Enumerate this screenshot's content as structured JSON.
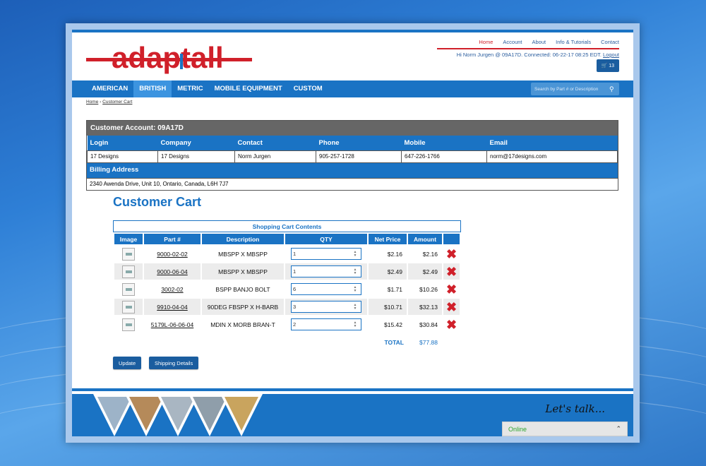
{
  "header": {
    "logo_text": "adaptall",
    "toplinks": [
      "Home",
      "Account",
      "About",
      "Info & Tutorials",
      "Contact"
    ],
    "user_line": "Hi Norm Jurgen @ 09A17D. Connected: 06-22-17 08:25 EDT.",
    "logout": "Logout",
    "cart_count": "13"
  },
  "nav": {
    "items": [
      "AMERICAN",
      "BRITISH",
      "METRIC",
      "MOBILE EQUIPMENT",
      "CUSTOM"
    ],
    "active": "BRITISH",
    "search_placeholder": "Search by Part # or Description"
  },
  "breadcrumb": {
    "home": "Home",
    "sep": "›",
    "current": "Customer Cart"
  },
  "account": {
    "title": "Customer Account: 09A17D",
    "headers": [
      "Login",
      "Company",
      "Contact",
      "Phone",
      "Mobile",
      "Email"
    ],
    "values": [
      "17 Designs",
      "17 Designs",
      "Norm Jurgen",
      "905-257-1728",
      "647-226-1766",
      "norm@17designs.com"
    ],
    "billing_label": "Billing Address",
    "billing_value": "2340 Awenda Drive, Unit 10, Ontario, Canada, L6H 7J7"
  },
  "cart": {
    "title": "Customer Cart",
    "caption": "Shopping Cart Contents",
    "headers": [
      "Image",
      "Part #",
      "Description",
      "QTY",
      "Net Price",
      "Amount",
      ""
    ],
    "rows": [
      {
        "part": "9000-02-02",
        "desc": "MBSPP X MBSPP",
        "qty": "1",
        "price": "$2.16",
        "amount": "$2.16"
      },
      {
        "part": "9000-06-04",
        "desc": "MBSPP X MBSPP",
        "qty": "1",
        "price": "$2.49",
        "amount": "$2.49"
      },
      {
        "part": "3002-02",
        "desc": "BSPP BANJO BOLT",
        "qty": "6",
        "price": "$1.71",
        "amount": "$10.26"
      },
      {
        "part": "9910-04-04",
        "desc": "90DEG FBSPP X H-BARB",
        "qty": "3",
        "price": "$10.71",
        "amount": "$32.13"
      },
      {
        "part": "5179L-06-06-04",
        "desc": "MDIN X MORB BRAN-T",
        "qty": "2",
        "price": "$15.42",
        "amount": "$30.84"
      }
    ],
    "total_label": "TOTAL",
    "total_value": "$77.88",
    "update_label": "Update",
    "shipping_label": "Shipping Details"
  },
  "footer": {
    "lets_talk": "Let's talk...",
    "chat_status": "Online"
  },
  "colors": {
    "brand_blue": "#1a73c4",
    "brand_red": "#d0202a"
  }
}
